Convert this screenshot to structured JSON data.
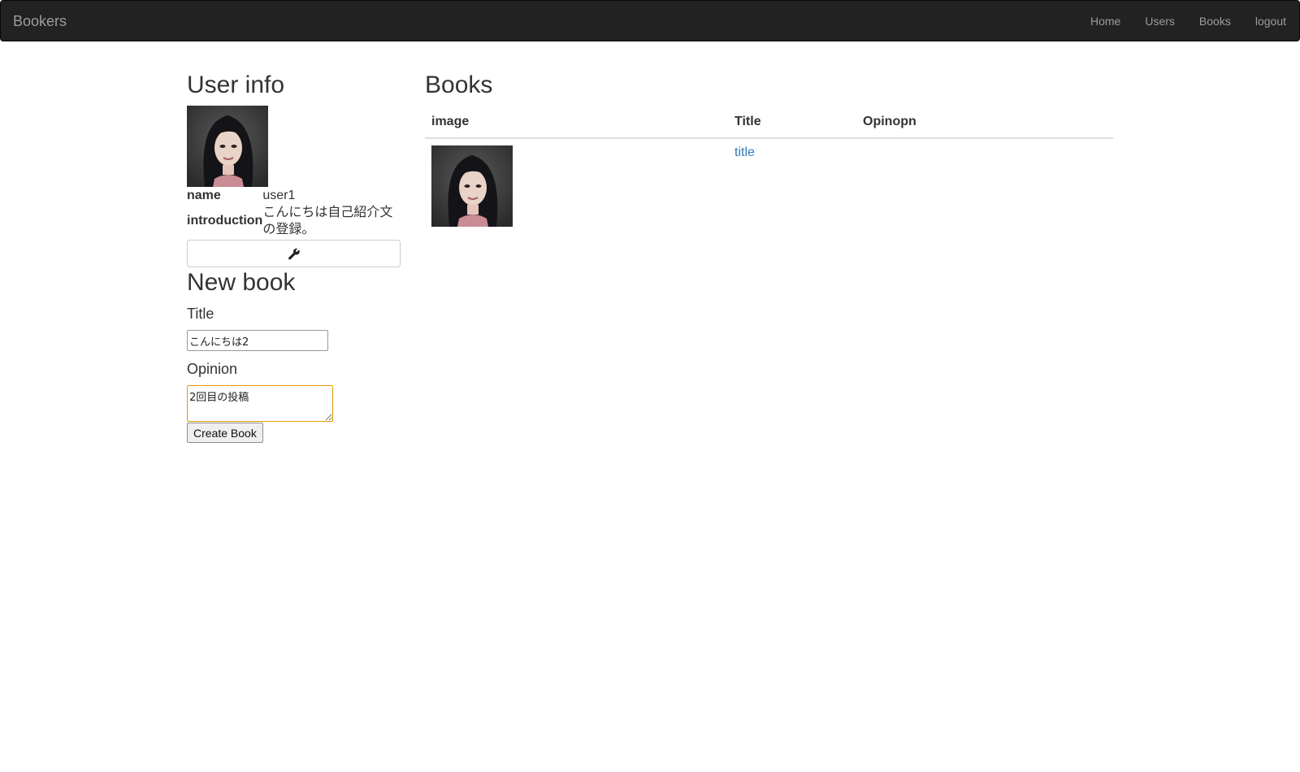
{
  "navbar": {
    "brand": "Bookers",
    "links": [
      "Home",
      "Users",
      "Books",
      "logout"
    ]
  },
  "user_info": {
    "heading": "User info",
    "name_label": "name",
    "name_value": "user1",
    "introduction_label": "introduction",
    "introduction_value": "こんにちは自己紹介文の登録。",
    "edit_icon": "wrench-icon"
  },
  "new_book": {
    "heading": "New book",
    "title_label": "Title",
    "title_value": "こんにちは2",
    "opinion_label": "Opinion",
    "opinion_value": "2回目の投稿",
    "submit_label": "Create Book"
  },
  "books": {
    "heading": "Books",
    "columns": [
      "image",
      "Title",
      "Opinopn"
    ],
    "rows": [
      {
        "title": "title",
        "opinion": ""
      }
    ]
  },
  "colors": {
    "navbar_bg": "#222222",
    "nav_text": "#9d9d9d",
    "link": "#337ab7",
    "focus_border": "#e59700"
  }
}
